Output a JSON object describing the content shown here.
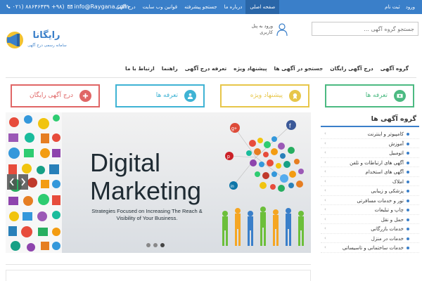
{
  "topbar": {
    "phone": "۰۲۱) ۸۸۶۴۶۴۳۹ +۹۸)",
    "email": "info@Raygana.com",
    "menu": [
      "صفحه اصلی",
      "درباره ما",
      "جستجو پیشرفته",
      "قوانین وب سایت",
      "درج آگهی"
    ],
    "auth": [
      "ورود",
      "ثبت نام"
    ],
    "bg_color": "#3a7fc9"
  },
  "header": {
    "search_placeholder": "جستجو گروه آگهی ...",
    "login_text": "ورود به پنل کاربری",
    "logo": {
      "name": "رایگانا",
      "tagline": "سامانه رسمی درج آگهی"
    }
  },
  "nav": {
    "items": [
      "گروه آگهی",
      "درج آگهی رایگان",
      "جستجو در آگهی ها",
      "پیشنهاد ویژه",
      "تعرفه درج آگهی",
      "راهنما",
      "ارتباط با ما"
    ]
  },
  "features": [
    {
      "label": "تعرفه ها",
      "color": "#4cba82",
      "icon": "money-icon"
    },
    {
      "label": "پیشنهاد ویژه",
      "color": "#e7c64a",
      "icon": "medal-icon"
    },
    {
      "label": "تعرفه ها",
      "color": "#3fb3d4",
      "icon": "users-icon"
    },
    {
      "label": "درج آگهی رایگان",
      "color": "#e06666",
      "icon": "plus-icon"
    }
  ],
  "sidebar": {
    "title": "گروه آگهی ها",
    "items": [
      "کامپیوتر و اینترنت",
      "آموزش",
      "اتومبیل",
      "آگهی های ارتباطات و تلفن",
      "آگهی های استخدام",
      "املاک",
      "پزشکی و زیبایی",
      "تور و خدمات مسافرتی",
      "چاپ و تبلیغات",
      "حمل و نقل",
      "خدمات بازرگانی",
      "خدمات در منزل",
      "خدمات ساختمانی و تاسیساتی"
    ]
  },
  "slider": {
    "title_line1": "Digital",
    "title_line2": "Marketing",
    "subtitle": "Strategies Focused on Increasing The Reach & Visibility of Your Business.",
    "slide_count": 3,
    "active_slide": 3
  }
}
